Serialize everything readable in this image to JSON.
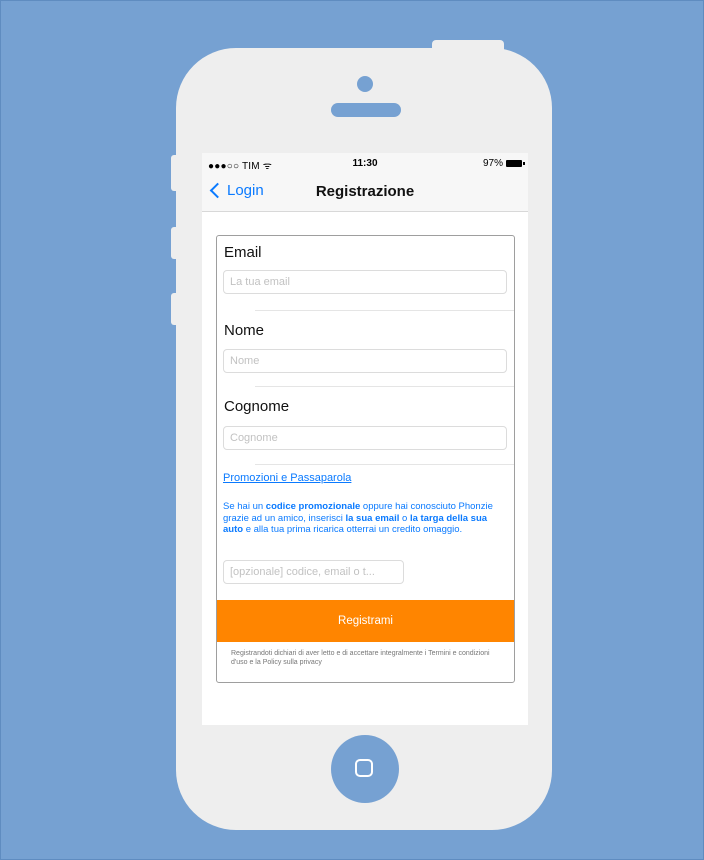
{
  "colors": {
    "background": "#76a1d2",
    "phone_body": "#eeeeee",
    "accent_link": "#0a7aff",
    "submit_button": "#ff8500"
  },
  "statusbar": {
    "carrier": "●●●○○ TIM ᯤ",
    "time": "11:30",
    "battery": "97%"
  },
  "navbar": {
    "back_label": "Login",
    "title": "Registrazione"
  },
  "form": {
    "email_label": "Email",
    "email_placeholder": "La tua email",
    "nome_label": "Nome",
    "nome_placeholder": "Nome",
    "cognome_label": "Cognome",
    "cognome_placeholder": "Cognome",
    "promo_title": "Promozioni e Passaparola",
    "promo_text": {
      "p1": "Se hai un ",
      "b1": "codice promozionale",
      "p2": " oppure hai conosciuto Phonzie grazie ad un amico, inserisci ",
      "b2": "la sua email",
      "p3": " o ",
      "b3": "la targa della sua auto",
      "p4": " e alla tua prima ricarica otterrai un credito omaggio."
    },
    "promo_placeholder": "[opzionale] codice, email o t...",
    "submit_label": "Registrami",
    "terms": "Registrandoti dichiari di aver letto e di accettare integralmente i Termini e condizioni d'uso e la Policy sulla privacy"
  },
  "icons": {
    "back": "chevron-left-icon",
    "wifi": "wifi-icon",
    "battery": "battery-icon",
    "home": "home-button-icon"
  }
}
